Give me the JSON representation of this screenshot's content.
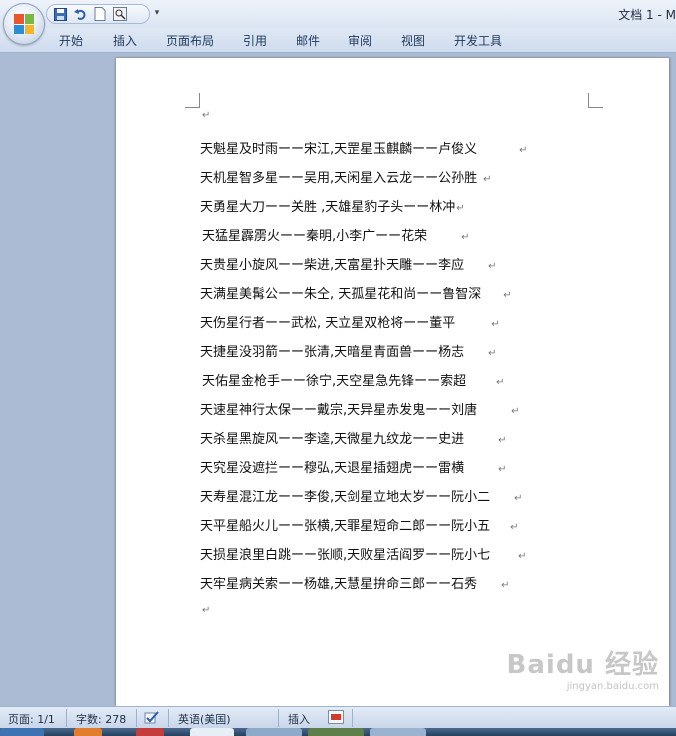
{
  "window": {
    "title": "文档 1 - M"
  },
  "ribbon": {
    "tabs": [
      "开始",
      "插入",
      "页面布局",
      "引用",
      "邮件",
      "审阅",
      "视图",
      "开发工具"
    ]
  },
  "quick_access": {
    "icons": [
      "save-icon",
      "undo-icon",
      "new-document-icon",
      "print-preview-icon"
    ]
  },
  "document": {
    "lines": [
      "天魁星及时雨ーー宋江,天罡星玉麒麟ーー卢俊义",
      "天机星智多星ーー吴用,天闲星入云龙ーー公孙胜",
      "天勇星大刀ーー关胜 ,天雄星豹子头ーー林冲",
      "天猛星霹雳火ーー秦明,小李广ーー花荣",
      "天贵星小旋风ーー柴进,天富星扑天雕ーー李应",
      "天满星美髯公ーー朱仝, 天孤星花和尚ーー鲁智深",
      "天伤星行者ーー武松, 天立星双枪将ーー董平",
      "天捷星没羽箭ーー张清,天暗星青面兽ーー杨志",
      "天佑星金枪手ーー徐宁,天空星急先锋ーー索超",
      "天速星神行太保ーー戴宗,天异星赤发鬼ーー刘唐",
      "天杀星黑旋风ーー李逵,天微星九纹龙ーー史进",
      "天究星没遮拦ーー穆弘,天退星插翅虎ーー雷横",
      "天寿星混江龙ーー李俊,天剑星立地太岁ーー阮小二",
      "天平星船火儿ーー张横,天罪星短命二郎ーー阮小五",
      "天损星浪里白跳ーー张顺,天败星活阎罗ーー阮小七",
      "天牢星病关索ーー杨雄,天慧星拚命三郎ーー石秀"
    ],
    "paragraph_mark": "↵"
  },
  "watermark": {
    "brand": "Baidu 经验",
    "url": "jingyan.baidu.com"
  },
  "statusbar": {
    "page": "页面: 1/1",
    "words": "字数: 278",
    "language": "英语(美国)",
    "mode": "插入"
  }
}
